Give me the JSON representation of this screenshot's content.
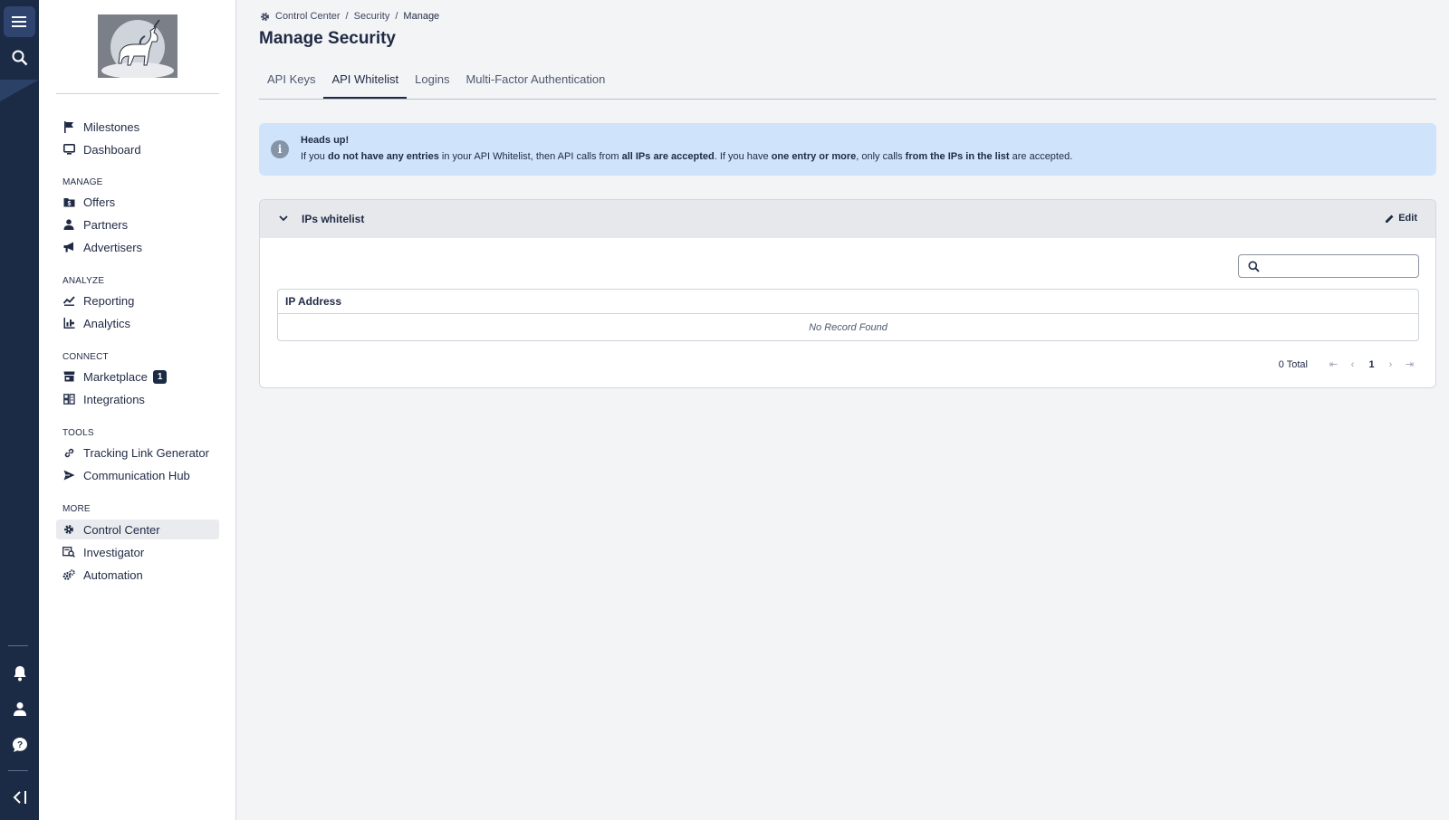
{
  "rail": {
    "icons": [
      "menu-icon",
      "search-icon",
      "bell-icon",
      "user-icon",
      "help-icon",
      "collapse-icon"
    ]
  },
  "sidebar": {
    "top_items": [
      {
        "label": "Milestones",
        "icon": "flag-icon"
      },
      {
        "label": "Dashboard",
        "icon": "monitor-icon"
      }
    ],
    "groups": [
      {
        "label": "MANAGE",
        "items": [
          {
            "label": "Offers",
            "icon": "offers-icon"
          },
          {
            "label": "Partners",
            "icon": "partners-icon"
          },
          {
            "label": "Advertisers",
            "icon": "megaphone-icon"
          }
        ]
      },
      {
        "label": "ANALYZE",
        "items": [
          {
            "label": "Reporting",
            "icon": "reporting-icon"
          },
          {
            "label": "Analytics",
            "icon": "analytics-icon"
          }
        ]
      },
      {
        "label": "CONNECT",
        "items": [
          {
            "label": "Marketplace",
            "icon": "store-icon",
            "badge": "1"
          },
          {
            "label": "Integrations",
            "icon": "integrations-icon"
          }
        ]
      },
      {
        "label": "TOOLS",
        "items": [
          {
            "label": "Tracking Link Generator",
            "icon": "link-icon"
          },
          {
            "label": "Communication Hub",
            "icon": "send-icon"
          }
        ]
      },
      {
        "label": "MORE",
        "items": [
          {
            "label": "Control Center",
            "icon": "gear-icon",
            "active": true
          },
          {
            "label": "Investigator",
            "icon": "investigator-icon"
          },
          {
            "label": "Automation",
            "icon": "automation-icon"
          }
        ]
      }
    ]
  },
  "breadcrumb": {
    "items": [
      "Control Center",
      "Security",
      "Manage"
    ],
    "separator": "/"
  },
  "page": {
    "title": "Manage Security"
  },
  "tabs": [
    {
      "label": "API Keys",
      "active": false
    },
    {
      "label": "API Whitelist",
      "active": true
    },
    {
      "label": "Logins",
      "active": false
    },
    {
      "label": "Multi-Factor Authentication",
      "active": false
    }
  ],
  "alert": {
    "title": "Heads up!",
    "segments": [
      {
        "text": "If you ",
        "bold": false
      },
      {
        "text": "do not have any entries",
        "bold": true
      },
      {
        "text": " in your API Whitelist, then API calls from ",
        "bold": false
      },
      {
        "text": "all IPs are accepted",
        "bold": true
      },
      {
        "text": ". If you have ",
        "bold": false
      },
      {
        "text": "one entry or more",
        "bold": true
      },
      {
        "text": ", only calls ",
        "bold": false
      },
      {
        "text": "from the IPs in the list",
        "bold": true
      },
      {
        "text": " are accepted.",
        "bold": false
      }
    ]
  },
  "panel": {
    "title": "IPs whitelist",
    "edit_label": "Edit",
    "search_placeholder": "",
    "table": {
      "columns": [
        "IP Address"
      ],
      "rows": [],
      "empty_text": "No Record Found"
    },
    "pagination": {
      "total_label": "0 Total",
      "current_page": "1",
      "first": "⇤",
      "prev": "‹",
      "next": "›",
      "last": "⇥"
    }
  },
  "colors": {
    "rail_bg": "#1c2b45",
    "alert_bg": "#cfe3fa",
    "accent": "#1f2a44"
  }
}
